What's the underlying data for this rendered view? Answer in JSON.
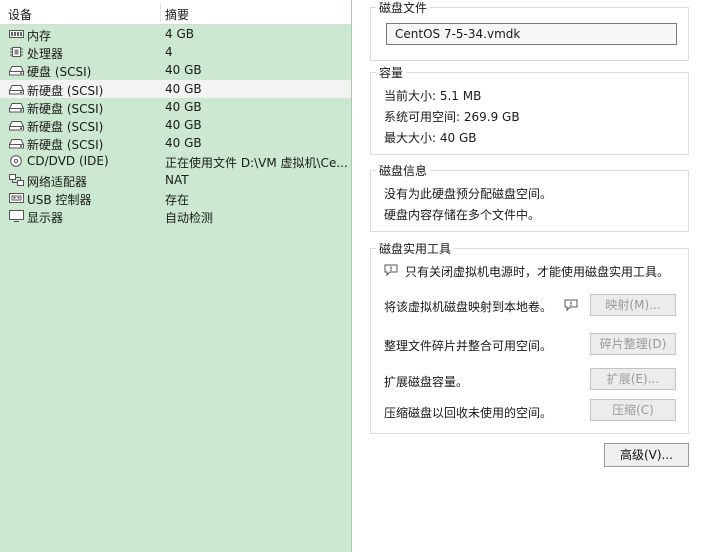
{
  "device_list": {
    "headers": {
      "device": "设备",
      "summary": "摘要"
    },
    "rows": [
      {
        "icon": "memory-icon",
        "name": "内存",
        "summary": "4 GB"
      },
      {
        "icon": "processor-icon",
        "name": "处理器",
        "summary": "4"
      },
      {
        "icon": "hard-disk-icon",
        "name": "硬盘 (SCSI)",
        "summary": "40 GB"
      },
      {
        "icon": "hard-disk-icon",
        "name": "新硬盘 (SCSI)",
        "summary": "40 GB",
        "selected": true
      },
      {
        "icon": "hard-disk-icon",
        "name": "新硬盘 (SCSI)",
        "summary": "40 GB"
      },
      {
        "icon": "hard-disk-icon",
        "name": "新硬盘 (SCSI)",
        "summary": "40 GB"
      },
      {
        "icon": "hard-disk-icon",
        "name": "新硬盘 (SCSI)",
        "summary": "40 GB"
      },
      {
        "icon": "cd-dvd-icon",
        "name": "CD/DVD (IDE)",
        "summary": "正在使用文件 D:\\VM 虚拟机\\Ce..."
      },
      {
        "icon": "network-adapter-icon",
        "name": "网络适配器",
        "summary": "NAT"
      },
      {
        "icon": "usb-controller-icon",
        "name": "USB 控制器",
        "summary": "存在"
      },
      {
        "icon": "display-icon",
        "name": "显示器",
        "summary": "自动检测"
      }
    ]
  },
  "disk_file": {
    "title": "磁盘文件",
    "value": "CentOS 7-5-34.vmdk"
  },
  "capacity": {
    "title": "容量",
    "current_size": "当前大小: 5.1 MB",
    "system_free": "系统可用空间: 269.9 GB",
    "max_size": "最大大小: 40 GB"
  },
  "disk_info": {
    "title": "磁盘信息",
    "line1": "没有为此硬盘预分配磁盘空间。",
    "line2": "硬盘内容存储在多个文件中。"
  },
  "disk_utilities": {
    "title": "磁盘实用工具",
    "notice": "只有关闭虚拟机电源时，才能使用磁盘实用工具。",
    "map_text": "将该虚拟机磁盘映射到本地卷。",
    "map_button": "映射(M)...",
    "defrag_text": "整理文件碎片并整合可用空间。",
    "defrag_button": "碎片整理(D)",
    "expand_text": "扩展磁盘容量。",
    "expand_button": "扩展(E)...",
    "compact_text": "压缩磁盘以回收未使用的空间。",
    "compact_button": "压缩(C)"
  },
  "advanced_button": "高级(V)..."
}
